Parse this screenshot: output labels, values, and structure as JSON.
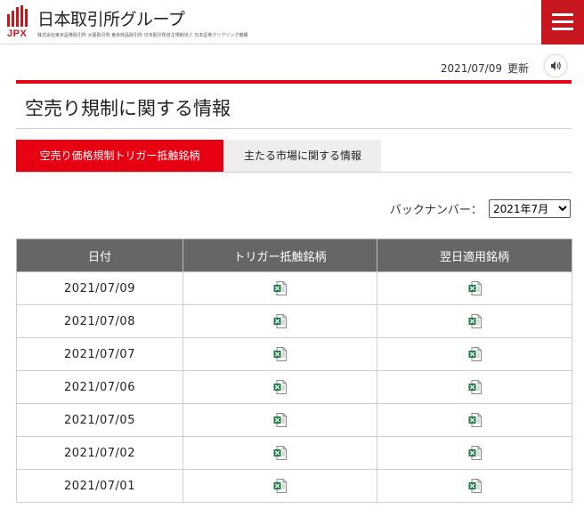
{
  "header": {
    "logo_mark_text": "JPX",
    "group_name": "日本取引所グループ",
    "subsidiaries": "株式会社東京証券取引所 大阪取引所 東京商品取引所 日本取引所自主規制法人 日本証券クリアリング機構"
  },
  "update": {
    "date": "2021/07/09",
    "label": "更新"
  },
  "page": {
    "title": "空売り規制に関する情報"
  },
  "tabs": [
    {
      "label": "空売り価格規制トリガー抵触銘柄",
      "active": true
    },
    {
      "label": "主たる市場に関する情報",
      "active": false
    }
  ],
  "backnumber": {
    "label": "バックナンバー：",
    "selected": "2021年7月"
  },
  "table": {
    "headers": [
      "日付",
      "トリガー抵触銘柄",
      "翌日適用銘柄"
    ],
    "rows": [
      {
        "date": "2021/07/09"
      },
      {
        "date": "2021/07/08"
      },
      {
        "date": "2021/07/07"
      },
      {
        "date": "2021/07/06"
      },
      {
        "date": "2021/07/05"
      },
      {
        "date": "2021/07/02"
      },
      {
        "date": "2021/07/01"
      }
    ],
    "file_icon": "excel-file-icon"
  },
  "colors": {
    "brand_red": "#c8161e",
    "accent_red": "#e60012",
    "table_header_bg": "#666666",
    "excel_green": "#1d7a45"
  }
}
